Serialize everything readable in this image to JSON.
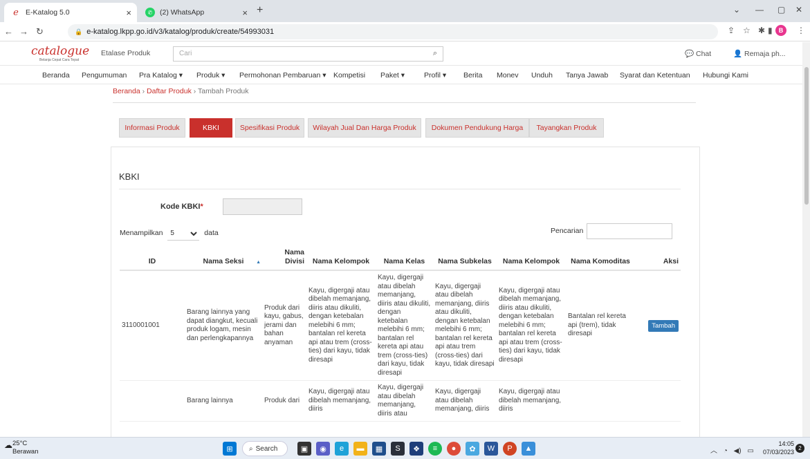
{
  "browser": {
    "tabs": [
      {
        "title": "E-Katalog 5.0",
        "icon": "e-logo-icon"
      },
      {
        "title": "(2) WhatsApp",
        "icon": "whatsapp-icon"
      }
    ],
    "url": "e-katalog.lkpp.go.id/v3/katalog/produk/create/54993031",
    "profile_initial": "B"
  },
  "site": {
    "logo": "catalogue",
    "logo_tagline": "Belanja Cepat Cara Tepat",
    "etalase_label": "Etalase Produk",
    "search_placeholder": "Cari",
    "chat_label": "Chat",
    "user_label": "Remaja ph..."
  },
  "menu": [
    "Beranda",
    "Pengumuman",
    "Pra Katalog ▾",
    "Produk ▾",
    "Permohonan Pembaruan ▾",
    "Kompetisi",
    "Paket ▾",
    "Profil ▾",
    "Berita",
    "Monev",
    "Unduh",
    "Tanya Jawab",
    "Syarat dan Ketentuan",
    "Hubungi Kami"
  ],
  "breadcrumb": {
    "home": "Beranda",
    "list": "Daftar Produk",
    "current": "Tambah Produk",
    "sep": "›"
  },
  "wizard_tabs": [
    "Informasi Produk",
    "KBKI",
    "Spesifikasi Produk",
    "Wilayah Jual Dan Harga Produk",
    "Dokumen Pendukung Harga",
    "Tayangkan Produk"
  ],
  "active_tab": "KBKI",
  "panel": {
    "title": "KBKI",
    "kode_label": "Kode KBKI",
    "required_mark": "*",
    "show_label": "Menampilkan",
    "page_size": "5",
    "data_label": "data",
    "search_label": "Pencarian"
  },
  "table": {
    "headers": [
      "ID",
      "Nama Seksi",
      "Nama Divisi",
      "Nama Kelompok",
      "Nama Kelas",
      "Nama Subkelas",
      "Nama Kelompok",
      "Nama Komoditas",
      "Aksi"
    ],
    "rows": [
      [
        "3110001001",
        "Barang lainnya yang dapat diangkut, kecuali produk logam, mesin dan perlengkapannya",
        "Produk dari kayu, gabus, jerami dan bahan anyaman",
        "Kayu, digergaji atau dibelah memanjang, diiris atau dikuliti, dengan ketebalan melebihi 6 mm; bantalan rel kereta api atau trem (cross-ties) dari kayu, tidak diresapi",
        "Kayu, digergaji atau dibelah memanjang, diiris atau dikuliti, dengan ketebalan melebihi 6 mm; bantalan rel kereta api atau trem (cross-ties) dari kayu, tidak diresapi",
        "Kayu, digergaji atau dibelah memanjang, diiris atau dikuliti, dengan ketebalan melebihi 6 mm; bantalan rel kereta api atau trem (cross-ties) dari kayu, tidak diresapi",
        "Kayu, digergaji atau dibelah memanjang, diiris atau dikuliti, dengan ketebalan melebihi 6 mm; bantalan rel kereta api atau trem (cross-ties) dari kayu, tidak diresapi",
        "Bantalan rel kereta api (trem), tidak diresapi",
        "Tambah"
      ],
      [
        "",
        "Barang lainnya",
        "Produk dari",
        "Kayu, digergaji atau dibelah memanjang, diiris",
        "Kayu, digergaji atau dibelah memanjang, diiris atau",
        "Kayu, digergaji atau dibelah memanjang, diiris",
        "Kayu, digergaji atau dibelah memanjang, diiris",
        "",
        ""
      ]
    ]
  },
  "taskbar": {
    "temp": "25°C",
    "weather": "Berawan",
    "search_label": "Search",
    "time": "14:05",
    "date": "07/03/2023",
    "notif_count": "2"
  }
}
